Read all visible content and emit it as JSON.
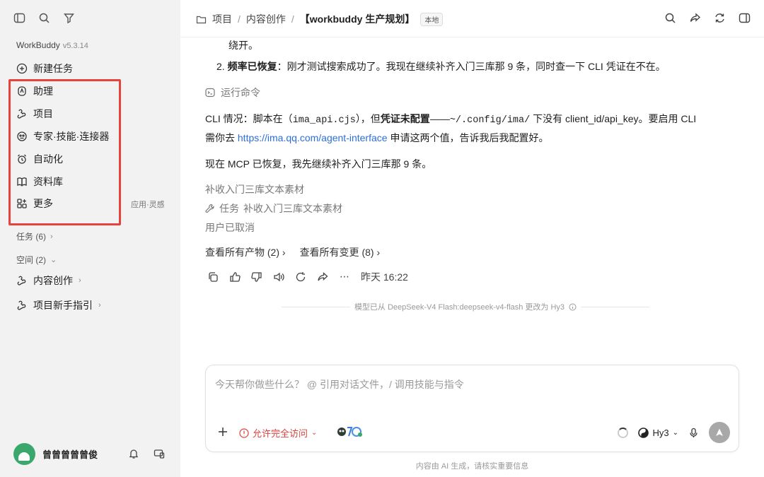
{
  "sidebar": {
    "app_name": "WorkBuddy",
    "app_version": "v5.3.14",
    "new_task": "新建任务",
    "nav": [
      "助理",
      "项目",
      "专家·技能·连接器",
      "自动化",
      "资料库",
      "更多"
    ],
    "more_hint": "应用·灵感",
    "tasks_section": "任务 (6)",
    "spaces_section": "空间 (2)",
    "spaces": [
      "内容创作",
      "项目新手指引"
    ],
    "username": "曾曾曾曾曾俊",
    "highlight_color": "#e8423c"
  },
  "header": {
    "crumb_root": "项目",
    "sep": "/",
    "crumb_space": "内容创作",
    "title": "【workbuddy 生产规划】",
    "tag": "本地"
  },
  "chat": {
    "line_wrap": "绕开。",
    "item2_num": "2.",
    "item2_bold": "频率已恢复",
    "item2_rest": "：刚才测试搜索成功了。我现在继续补齐入门三库那 9 条，同时查一下 CLI 凭证在不在。",
    "run_cmd": "运行命令",
    "cli_p1": "CLI 情况：脚本在（",
    "cli_code1": "ima_api.cjs",
    "cli_p2": "），但",
    "cli_bold": "凭证未配置",
    "cli_p3": "——",
    "cli_code2": "~/.config/ima/",
    "cli_p4": " 下没有 client_id/api_key。要启用 CLI",
    "cli2_p1": "需你去 ",
    "cli2_link": "https://ima.qq.com/agent-interface",
    "cli2_p2": " 申请这两个值，告诉我后我配置好。",
    "mcp_line": "现在 MCP 已恢复，我先继续补齐入门三库那 9 条。",
    "sub_title": "补收入门三库文本素材",
    "task_label": "任务",
    "task_name": "补收入门三库文本素材",
    "cancelled": "用户已取消",
    "artifacts": "查看所有产物 (2)",
    "changes": "查看所有变更 (8)",
    "timestamp": "昨天 16:22",
    "model_change": "模型已从 DeepSeek-V4 Flash:deepseek-v4-flash 更改为 Hy3"
  },
  "composer": {
    "placeholder": "今天帮你做些什么？ @ 引用对话文件，/ 调用技能与指令",
    "access": "允许完全访问",
    "model": "Hy3",
    "accent": "#d9423b"
  },
  "footer": "内容由 AI 生成，请核实重要信息"
}
